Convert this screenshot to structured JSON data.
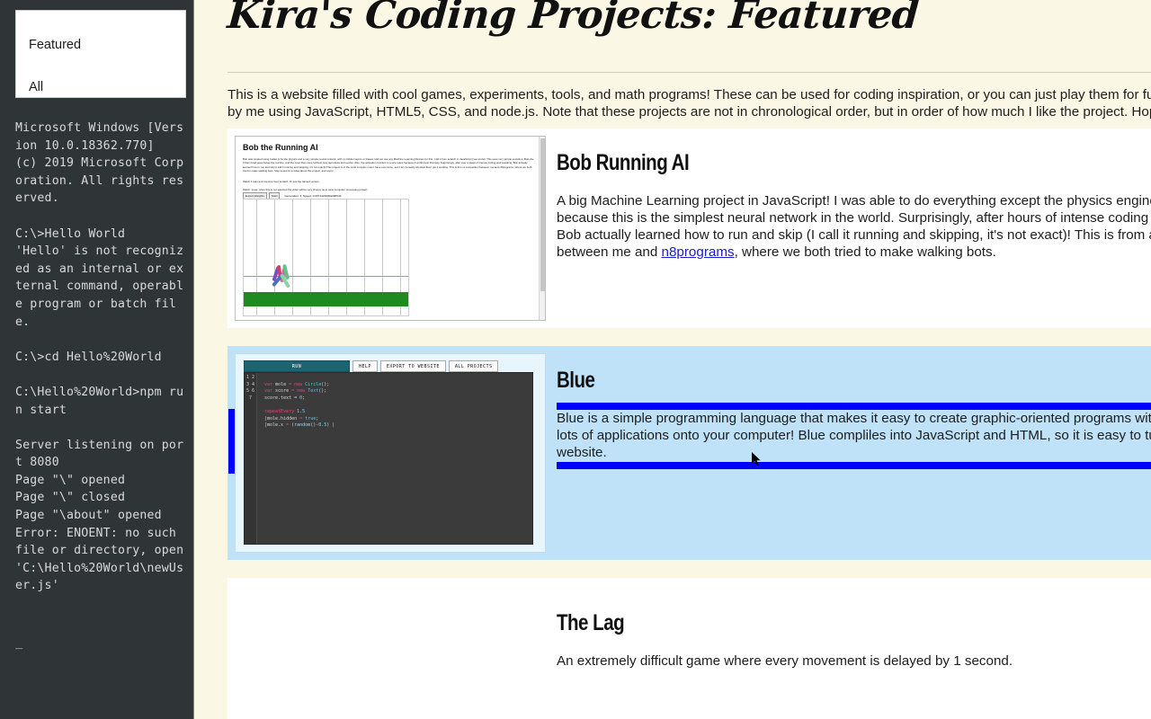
{
  "dropdown": {
    "options": [
      {
        "label": "Featured"
      },
      {
        "label": "All"
      }
    ]
  },
  "terminal": {
    "text": "Microsoft Windows [Version 10.0.18362.770]\n(c) 2019 Microsoft Corporation. All rights reserved.\n\nC:\\>Hello World\n'Hello' is not recognized as an internal or external command, operable program or batch file.\n\nC:\\>cd Hello%20World\n\nC:\\Hello%20World>npm run start\n\nServer listening on port 8080\nPage \"\\\" opened\nPage \"\\\" closed\nPage \"\\about\" opened\nError: ENOENT: no such file or directory, open 'C:\\Hello%20World\\newUser.js'",
    "caret": "_"
  },
  "page": {
    "title": "Kira's Coding Projects: Featured",
    "intro_lines": [
      "This is a website filled with cool games, experiments, tools, and math programs! These can be used for coding inspiration, or you can just play them for fun. The",
      "by me using JavaScript, HTML5, CSS, and node.js. Note that these projects are not in chronological order, but in order of how much I like the project. Hope you"
    ]
  },
  "cards": [
    {
      "id": "bob",
      "title": "Bob Running AI",
      "desc_lines": [
        "A big Machine Learning project in JavaScript! I was able to do everything except the physics engine fr",
        "because this is the simplest neural network in the world. Surprisingly, after hours of intense coding an",
        "Bob actually learned how to run and skip (I call it running and skipping, it's not exact)! This is from a c",
        "between me and "
      ],
      "link_text": "n8programs",
      "desc_tail": ", where we both tried to make walking bots.",
      "thumbnail": {
        "heading": "Bob the Running AI",
        "para1": "Bob was created using matter.js for the physics and a very simple neural network, with no hidden layers or biases I did not use any Machine Learning libraries for this, I did it from scratch in JavaScript (see src/ai). This uses very simple evolution. Bots die if their head goes below the red line, and the ones that move furthest may reproduce and evolve. Also, the activation function is a sine wave because it works best that way. Surprisingly, after over a week of intense coding and tweaking, Bob actually learned how to run and skip (I call it running and skipping, it's not exact)! This project is of the most complex ones I have ever done, and I am honestly shocked that I got it working. This is from a competition between me and n8programs, where we both tried to make walking bots. Stay tuned for a video about this project, and enjoy!",
        "para2": "Watch it train and improve from scratch: Or just the trained version.",
        "para3": "Watch: (note: when this is not selected the video will be very choppy as to save computer processing power)",
        "button_export": "Export Weights",
        "button_start": "Start",
        "stat": "Generation: 4, Speed: 0.0071424000a000544"
      }
    },
    {
      "id": "blue",
      "title": "Blue",
      "desc_lines": [
        "Blue is a simple programming language that makes it easy to create graphic-oriented programs witho",
        "lots of applications onto your computer! Blue compliles into JavaScript and HTML, so it is easy to tur",
        "website."
      ],
      "thumbnail": {
        "tabs": [
          {
            "label": "RUN",
            "active": true
          },
          {
            "label": "HELP",
            "active": false
          },
          {
            "label": "EXPORT TO WEBSITE",
            "active": false
          },
          {
            "label": "ALL PROJECTS",
            "active": false
          }
        ],
        "line_numbers": "1\n2\n3\n4\n5\n6\n7",
        "code_lines": [
          "var mole = new Circle();",
          "var score = new Text();",
          "score.text = 0;",
          "",
          "repeatEvery 1.5",
          "|mole.hidden = true;",
          "|mole.x = (random()-0.5) |"
        ]
      }
    },
    {
      "id": "lag",
      "title": "The Lag",
      "desc_lines": [
        "An extremely difficult game where every movement is delayed by 1 second."
      ]
    }
  ],
  "colors": {
    "page_background": "#faf7e4",
    "terminal_background": "#2f3437",
    "terminal_text": "#d8dadb",
    "card_background": "#ffffff",
    "blue_card_background": "#bfe2f8",
    "selection_blue": "#0000ff",
    "link_blue": "#1a1ad0",
    "editor_background": "#3b3b3b",
    "active_tab": "#1d6470"
  }
}
